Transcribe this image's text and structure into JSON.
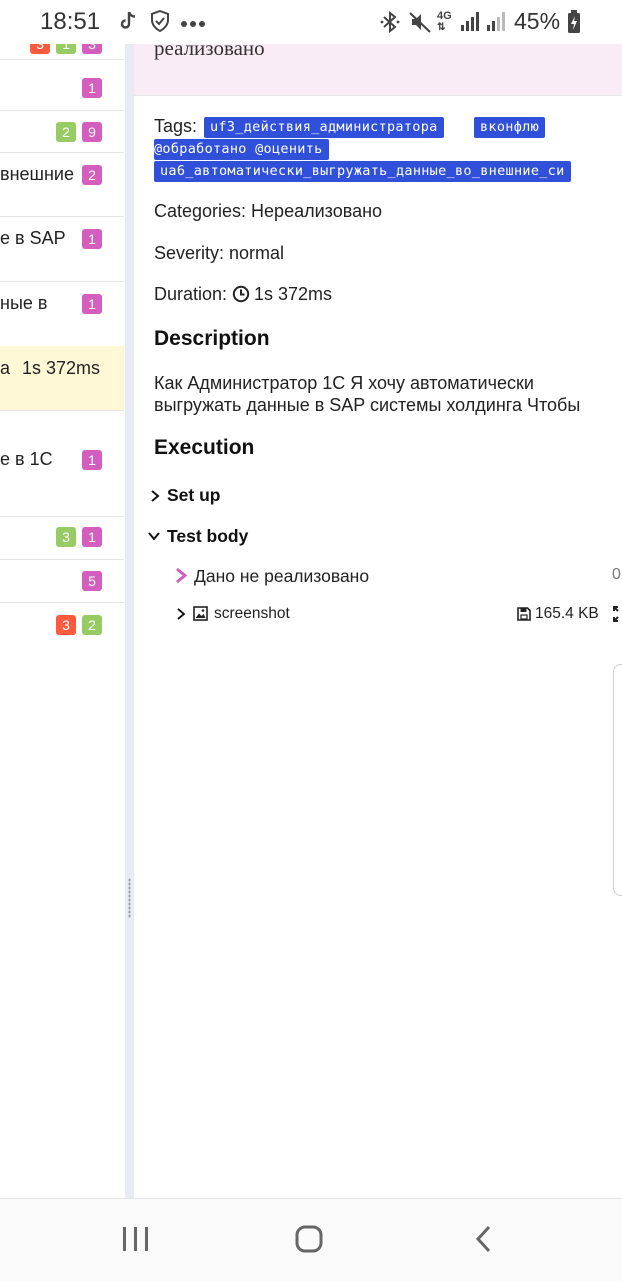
{
  "status_bar": {
    "time": "18:51",
    "battery": "45%",
    "icons": [
      "tiktok-icon",
      "shield-check-icon",
      "more-dots-icon",
      "bluetooth-icon",
      "mute-icon",
      "4g-icon",
      "signal-icon",
      "signal-icon",
      "battery-charging-icon"
    ],
    "network": "4G"
  },
  "left_list": {
    "rows": [
      {
        "text": "",
        "badges": [
          "3",
          "1",
          "3"
        ]
      },
      {
        "text": "",
        "badges": [
          "1"
        ]
      },
      {
        "text": "",
        "badges": [
          "2",
          "9"
        ]
      },
      {
        "text": "внешние",
        "badges": [
          "2"
        ]
      },
      {
        "text": "е в SAP",
        "badges": [
          "1"
        ]
      },
      {
        "text": "ные в",
        "badges": [
          "1"
        ]
      },
      {
        "text": "а",
        "duration": "1s 372ms",
        "badges": []
      },
      {
        "text": "е в 1С",
        "badges": [
          "1"
        ]
      },
      {
        "text": "",
        "badges": [
          "3",
          "1"
        ]
      },
      {
        "text": "",
        "badges": [
          "5"
        ]
      },
      {
        "text": "",
        "badges": [
          "3",
          "2"
        ]
      }
    ]
  },
  "detail": {
    "header_title": "реализовано",
    "tags_label": "Tags:",
    "tags": [
      "uf3_действия_администратора",
      "вконфлю",
      "@обработано @оценить",
      "ua6_автоматически_выгружать_данные_во_внешние_си"
    ],
    "categories": "Categories: Нереализовано",
    "severity": "Severity: normal",
    "duration_label": "Duration:",
    "duration_value": "1s 372ms",
    "description_heading": "Description",
    "description_text": "Как Администратор 1С Я хочу автоматически выгружать данные в SAP системы холдинга Чтобы",
    "execution_heading": "Execution",
    "setup_label": "Set up",
    "test_body_label": "Test body",
    "step_label": "Дано не реализовано",
    "step_time": "0",
    "attachment_label": "screenshot",
    "attachment_size": "165.4 KB"
  },
  "colors": {
    "failed": "#fd5a3e",
    "passed": "#97cc64",
    "unknown": "#d35ebe",
    "tag": "#3050d9",
    "header_bg": "#f9ecf6",
    "selected_row": "#fff8d6"
  }
}
